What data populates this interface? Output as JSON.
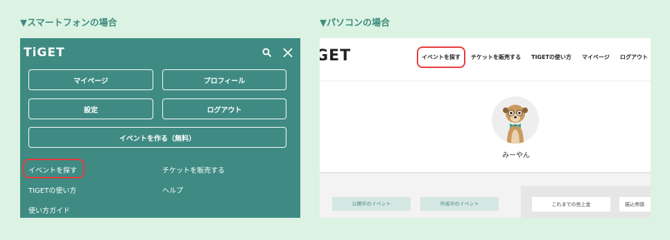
{
  "labels": {
    "smartphone": "▼スマートフォンの場合",
    "pc": "▼パソコンの場合"
  },
  "smartphone": {
    "logo": "TiGET",
    "icons": [
      "search-icon",
      "close-icon"
    ],
    "buttons": {
      "mypage": "マイページ",
      "profile": "プロフィール",
      "settings": "設定",
      "logout": "ログアウト",
      "create_event": "イベントを作る（無料）"
    },
    "links": {
      "find_event": "イベントを探す",
      "sell_tickets": "チケットを販売する",
      "how_to_use": "TIGETの使い方",
      "help": "ヘルプ",
      "guide": "使い方ガイド"
    }
  },
  "pc": {
    "logo": "GET",
    "nav": {
      "find_event": "イベントを探す",
      "sell_tickets": "チケットを販売する",
      "how_to_use": "TIGETの使い方",
      "mypage": "マイページ",
      "logout": "ログアウト"
    },
    "username": "みーやん",
    "tabs": {
      "public_events": "公開中のイベント",
      "draft_events": "作成中のイベント"
    },
    "right_buttons": {
      "sales": "これまでの売上金",
      "transfer": "振込申請"
    }
  },
  "colors": {
    "background": "#dcf3e3",
    "panel_green": "#3f8b83",
    "label_green": "#3d8a7e",
    "highlight_red": "#e83a3a"
  }
}
